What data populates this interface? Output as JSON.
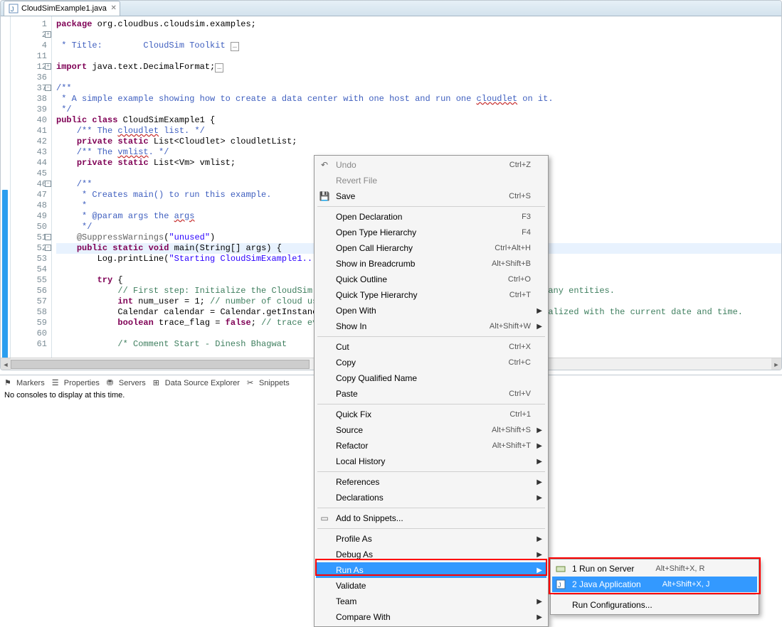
{
  "tab": {
    "filename": "CloudSimExample1.java"
  },
  "gutter_lines": [
    "1",
    "2",
    "4",
    "11",
    "12",
    "36",
    "37",
    "38",
    "39",
    "40",
    "41",
    "42",
    "43",
    "44",
    "45",
    "46",
    "47",
    "48",
    "49",
    "50",
    "51",
    "52",
    "53",
    "54",
    "55",
    "56",
    "57",
    "58",
    "59",
    "60",
    "61"
  ],
  "fold_marks": {
    "2": "plus",
    "5": "plus",
    "7": "minus",
    "16": "minus",
    "21": "minus",
    "22": "minus"
  },
  "code": {
    "l1": {
      "pre": "",
      "kw1": "package",
      "mid": " org.cloudbus.cloudsim.examples;",
      "post": ""
    },
    "l2": "",
    "l3a": " * Title:        CloudSim Toolkit",
    "l4": "",
    "l5": {
      "kw": "import",
      "rest": " java.text.DecimalFormat;"
    },
    "l6": "",
    "l7": "/**",
    "l8": " * A simple example showing how to create a data center with one host and run one cloudlet on it.",
    "l8err": "cloudlet",
    "l9": " */",
    "l10": {
      "kw1": "public",
      "kw2": "class",
      "name": " CloudSimExample1 {"
    },
    "l11": "    /** The cloudlet list. */",
    "l11err": "cloudlet",
    "l12": {
      "ind": "    ",
      "kw1": "private",
      "kw2": "static",
      "type": " List<Cloudlet> ",
      "var": "cloudletList",
      ";": ";"
    },
    "l13": "    /** The vmlist. */",
    "l13err": "vmlist",
    "l14": {
      "ind": "    ",
      "kw1": "private",
      "kw2": "static",
      "type": " List<Vm> ",
      "var": "vmlist",
      ";": ";"
    },
    "l15": "",
    "l16": "    /**",
    "l17": "     * Creates main() to run this example.",
    "l18": "     *",
    "l19": "     * @param args the args",
    "l19err": "args",
    "l20": "     */",
    "l21": {
      "ind": "    ",
      "ann": "@SuppressWarnings",
      "arg": "(\"unused\")"
    },
    "l22": {
      "ind": "    ",
      "kw1": "public",
      "kw2": "static",
      "kw3": "void",
      "sig": " main(String[] args) {"
    },
    "l23": {
      "ind": "        ",
      "call": "Log.",
      "m": "printLine",
      "args": "(",
      "str": "\"Starting CloudSimExample1...\"",
      ");": ");"
    },
    "l24": "",
    "l25": {
      "ind": "        ",
      "kw": "try",
      "rest": " {"
    },
    "l26": "            // First step: Initialize the CloudSim package. It should be called before creating any entities.",
    "l27": {
      "ind": "            ",
      "kw": "int",
      "rest": " num_user = 1; ",
      "com": "// number of cloud users"
    },
    "l28": {
      "ind": "            ",
      "rest": "Calendar calendar = Calendar.",
      "m": "getInstance",
      "args": "(); ",
      "com": "// Calendar whose fields have been initialized with the current date and time."
    },
    "l29": {
      "ind": "            ",
      "kw": "boolean",
      "rest": " trace_flag = ",
      "kw2": "false",
      "rest2": "; ",
      "com": "// trace events"
    },
    "l30": "",
    "l31": "            /* Comment Start - Dinesh Bhagwat"
  },
  "views": {
    "markers": "Markers",
    "properties": "Properties",
    "servers": "Servers",
    "dse": "Data Source Explorer",
    "snippets": "Snippets"
  },
  "console_msg": "No consoles to display at this time.",
  "menu": {
    "undo": {
      "label": "Undo",
      "sc": "Ctrl+Z"
    },
    "revert": {
      "label": "Revert File"
    },
    "save": {
      "label": "Save",
      "sc": "Ctrl+S"
    },
    "openDecl": {
      "label": "Open Declaration",
      "sc": "F3"
    },
    "openTypeH": {
      "label": "Open Type Hierarchy",
      "sc": "F4"
    },
    "openCallH": {
      "label": "Open Call Hierarchy",
      "sc": "Ctrl+Alt+H"
    },
    "showBread": {
      "label": "Show in Breadcrumb",
      "sc": "Alt+Shift+B"
    },
    "quickOutline": {
      "label": "Quick Outline",
      "sc": "Ctrl+O"
    },
    "quickTypeH": {
      "label": "Quick Type Hierarchy",
      "sc": "Ctrl+T"
    },
    "openWith": {
      "label": "Open With"
    },
    "showIn": {
      "label": "Show In",
      "sc": "Alt+Shift+W"
    },
    "cut": {
      "label": "Cut",
      "sc": "Ctrl+X"
    },
    "copy": {
      "label": "Copy",
      "sc": "Ctrl+C"
    },
    "copyQN": {
      "label": "Copy Qualified Name"
    },
    "paste": {
      "label": "Paste",
      "sc": "Ctrl+V"
    },
    "quickFix": {
      "label": "Quick Fix",
      "sc": "Ctrl+1"
    },
    "source": {
      "label": "Source",
      "sc": "Alt+Shift+S"
    },
    "refactor": {
      "label": "Refactor",
      "sc": "Alt+Shift+T"
    },
    "localHist": {
      "label": "Local History"
    },
    "references": {
      "label": "References"
    },
    "declarations": {
      "label": "Declarations"
    },
    "addSnip": {
      "label": "Add to Snippets..."
    },
    "profileAs": {
      "label": "Profile As"
    },
    "debugAs": {
      "label": "Debug As"
    },
    "runAs": {
      "label": "Run As"
    },
    "validate": {
      "label": "Validate"
    },
    "team": {
      "label": "Team"
    },
    "compareWith": {
      "label": "Compare With"
    }
  },
  "submenu": {
    "runServer": {
      "label": "1 Run on Server",
      "sc": "Alt+Shift+X, R"
    },
    "javaApp": {
      "label": "2 Java Application",
      "sc": "Alt+Shift+X, J"
    },
    "runConfig": {
      "label": "Run Configurations..."
    }
  }
}
